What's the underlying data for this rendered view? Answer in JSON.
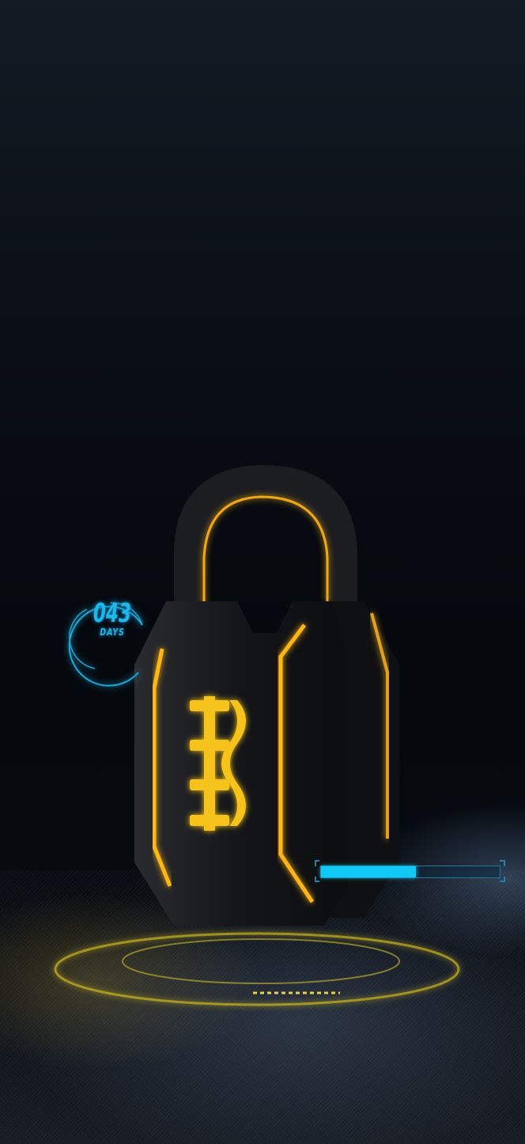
{
  "hud": {
    "counter_value": "043",
    "counter_unit": "DAYS",
    "progress_fraction": 0.53
  },
  "colors": {
    "accent_glow": "#ffc21a",
    "hud_cyan": "#12c8f5",
    "lock_body": "#16171a"
  },
  "icons": [
    "padlock-icon",
    "brand-logo-icon"
  ]
}
